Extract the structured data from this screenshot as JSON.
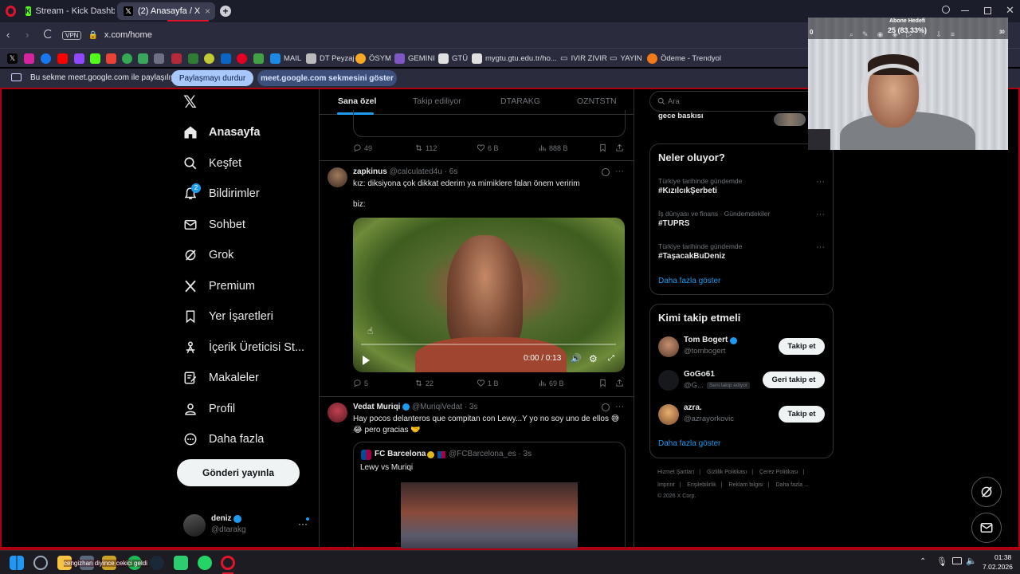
{
  "browser": {
    "tabs": [
      {
        "label": "Stream - Kick Dashboard"
      },
      {
        "label": "(2) Anasayfa / X"
      }
    ],
    "url": "x.com/home",
    "vpn": "VPN",
    "bookmarks": [
      "MAIL",
      "DT Peyzaj",
      "ÖSYM",
      "GEMINI",
      "GTÜ",
      "mygtu.gtu.edu.tr/ho...",
      "IVIR ZIVIR",
      "YAYIN",
      "Ödeme - Trendyol"
    ],
    "share": {
      "message": "Bu sekme meet.google.com ile paylaşılıyor",
      "stop_label": "Paylaşmayı durdur",
      "show_label": "meet.google.com sekmesini göster"
    }
  },
  "overlay": {
    "goal_label": "Abone Hedefi",
    "goal_value": "25 (83.33%)",
    "left_count": "0",
    "right_count": "30"
  },
  "nav": {
    "items": [
      {
        "label": "Anasayfa"
      },
      {
        "label": "Keşfet"
      },
      {
        "label": "Bildirimler",
        "badge": "2"
      },
      {
        "label": "Sohbet"
      },
      {
        "label": "Grok"
      },
      {
        "label": "Premium"
      },
      {
        "label": "Yer İşaretleri"
      },
      {
        "label": "İçerik Üreticisi St..."
      },
      {
        "label": "Makaleler"
      },
      {
        "label": "Profil"
      },
      {
        "label": "Daha fazla"
      }
    ],
    "post_button": "Gönderi yayınla",
    "account": {
      "name": "deniz",
      "handle": "@dtarakg"
    }
  },
  "timeline": {
    "tabs": [
      "Sana özel",
      "Takip ediliyor",
      "DTARAKG",
      "OZNTSTN"
    ],
    "tweets": [
      {
        "stats": {
          "replies": "49",
          "reposts": "112",
          "likes": "6 B",
          "views": "888 B"
        }
      },
      {
        "name": "zapkinus",
        "handle": "@calculated4u · 6s",
        "lines": [
          "kız: diksiyona çok dikkat ederim ya mimiklere falan önem veririm",
          "biz:"
        ],
        "video_time": "0:00 / 0:13",
        "stats": {
          "replies": "5",
          "reposts": "22",
          "likes": "1 B",
          "views": "69 B"
        }
      },
      {
        "name": "Vedat Muriqi",
        "handle": "@MuriqiVedat · 3s",
        "lines": [
          "Hay pocos delanteros que compitan con Lewy...Y yo no soy uno de ellos 😅",
          "😂 pero gracias 🤝"
        ],
        "quote": {
          "name": "FC Barcelona",
          "handle": "@FCBarcelona_es · 3s",
          "text": "Lewy vs Muriqi"
        }
      }
    ]
  },
  "sidebar": {
    "search_placeholder": "Ara",
    "top_snippet": "gece baskısı",
    "trends_title": "Neler oluyor?",
    "trends": [
      {
        "category": "Türkiye tarihinde gündemde",
        "tag": "#KızılcıkŞerbeti"
      },
      {
        "category": "İş dünyası ve finans · Gündemdekiler",
        "tag": "#TUPRS"
      },
      {
        "category": "Türkiye tarihinde gündemde",
        "tag": "#TaşacakBuDeniz"
      }
    ],
    "trends_more": "Daha fazla göster",
    "follow_title": "Kimi takip etmeli",
    "who": [
      {
        "name": "Tom Bogert",
        "handle": "@tombogert",
        "button": "Takip et"
      },
      {
        "name": "GoGo61",
        "handle": "@G...",
        "badge": "Seni takip ediyor",
        "button": "Geri takip et"
      },
      {
        "name": "azra.",
        "handle": "@azrayorkovic",
        "button": "Takip et"
      }
    ],
    "follow_more": "Daha fazla göster",
    "footer": {
      "line1": [
        "Hizmet Şartları",
        "Gizlilik Politikası",
        "Çerez Politikası"
      ],
      "line2": [
        "Imprint",
        "Erişilebilirlik",
        "Reklam bilgisi",
        "Daha fazla ..."
      ],
      "copyright": "© 2026 X Corp."
    }
  },
  "taskbar": {
    "notification": "cengizhan diyince cekici geldi",
    "time": "01:38",
    "date": "7.02.2026"
  }
}
